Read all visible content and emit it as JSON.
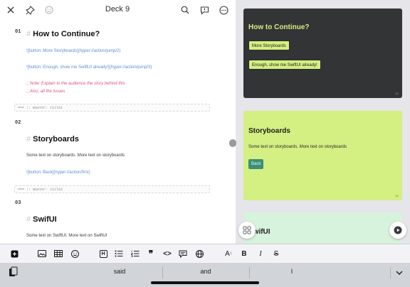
{
  "header": {
    "title": "Deck 9"
  },
  "editor": {
    "slides": [
      {
        "num": "01",
        "heading": "How to Continue?",
        "links": [
          "![button::More Storyboards](hyper://action/jump/2)",
          "![button::Enough, show me SwiftUI already!](hyper://action/jump/3)"
        ],
        "comments": [
          ";; Note: Explain to the audience the story behind this",
          ";; Also, all the issues"
        ],
        "master": "=== :: master: title1"
      },
      {
        "num": "02",
        "heading": "Storyboards",
        "body": "Some text on storyboards. More text on storyboards",
        "links": [
          "![button::Back](hyper://action/first)"
        ],
        "master": "=== :: master: title2"
      },
      {
        "num": "03",
        "heading": "SwifUI",
        "body": "Some text on SwiftUI. More text on SwiftUI"
      }
    ],
    "hash": "#"
  },
  "preview": {
    "cards": [
      {
        "title": "How to Continue?",
        "buttons": [
          "More Storyboards",
          "Enough, show me SwiftUI already!"
        ],
        "num": "01"
      },
      {
        "title": "Storyboards",
        "text": "Some text on storyboards. More text on storyboards",
        "buttons": [
          "Back"
        ],
        "num": "02"
      },
      {
        "title": "SwifUI"
      }
    ]
  },
  "toolbar": {
    "format_items": [
      "add-icon",
      "image-icon",
      "table-icon",
      "emoji-icon",
      "h-icon",
      "bullet-list-icon",
      "numbered-list-icon",
      "quote-icon",
      "code-icon",
      "comment-icon",
      "globe-icon",
      "font-size-icon"
    ],
    "bold": "B",
    "italic": "I",
    "strike": "S",
    "quote_glyph": "❞",
    "code_glyph": "<>",
    "h_glyph": "H",
    "font_glyph": "A",
    "font_sup": "↕"
  },
  "suggestions": [
    "said",
    "and",
    "I"
  ],
  "colors": {
    "accent_lime": "#d4ef82",
    "dark_card": "#323436",
    "teal_button": "#3b8f7a",
    "link_blue": "#5b8fd6",
    "comment_pink": "#d9557d",
    "mint_card": "#d7f2dd"
  }
}
